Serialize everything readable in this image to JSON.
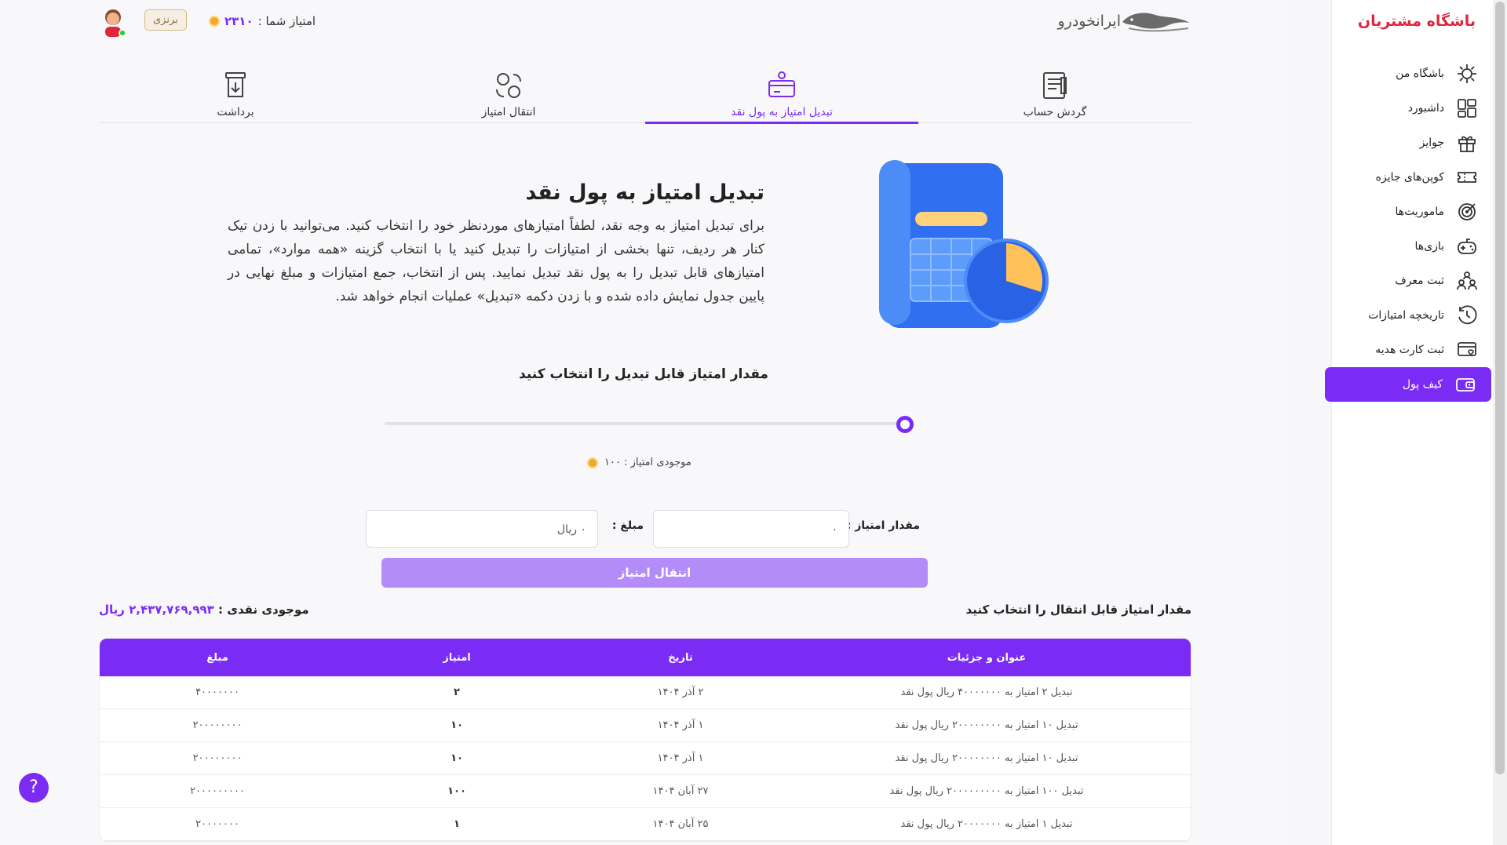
{
  "sidebar": {
    "title": "باشگاه مشتریان",
    "items": [
      {
        "label": "باشگاه من",
        "icon": "club-icon"
      },
      {
        "label": "داشبورد",
        "icon": "dashboard-icon"
      },
      {
        "label": "جوایز",
        "icon": "gift-icon"
      },
      {
        "label": "کوپن‌های جایزه",
        "icon": "ticket-icon"
      },
      {
        "label": "ماموریت‌ها",
        "icon": "target-icon"
      },
      {
        "label": "بازی‌ها",
        "icon": "gamepad-icon"
      },
      {
        "label": "ثبت معرف",
        "icon": "referral-icon"
      },
      {
        "label": "تاریخچه امتیازات",
        "icon": "history-icon"
      },
      {
        "label": "ثبت کارت هدیه",
        "icon": "gift-card-icon"
      },
      {
        "label": "کیف پول",
        "icon": "wallet-icon",
        "active": true
      }
    ]
  },
  "header": {
    "logo_text": "ایرانخودرو",
    "points_label": "امتیاز شما :",
    "points_value": "۲۳۱۰",
    "level_badge": "برنزی"
  },
  "tabs": [
    {
      "label": "گردش حساب",
      "icon": "statement-icon"
    },
    {
      "label": "تبدیل امتیاز به پول نقد",
      "icon": "convert-cash-icon",
      "active": true
    },
    {
      "label": "انتقال امتیاز",
      "icon": "transfer-points-icon"
    },
    {
      "label": "برداشت",
      "icon": "withdraw-icon"
    }
  ],
  "intro": {
    "title": "تبدیل امتیاز به پول نقد",
    "text": "برای تبدیل امتیاز به وجه نقد، لطفاً امتیازهای موردنظر خود را انتخاب کنید. می‌توانید با زدن تیک کنار هر ردیف، تنها بخشی از امتیازات را تبدیل کنید یا با انتخاب گزینه «همه موارد»، تمامی امتیازهای قابل تبدیل را به پول نقد تبدیل نمایید. پس از انتخاب، جمع امتیازات و مبلغ نهایی در پایین جدول نمایش داده شده و با زدن دکمه «تبدیل» عملیات انجام خواهد شد."
  },
  "converter": {
    "title": "مقدار امتیاز قابل تبدیل را انتخاب کنید",
    "slider_fraction": 1.0,
    "balance_text": "موجودی امتیاز : ۱۰۰",
    "points_label": "مقدار امتیاز :",
    "points_value": "۰",
    "amount_label": "مبلغ :",
    "amount_value": "۰ ریال",
    "submit_label": "انتقال امتیاز"
  },
  "summary": {
    "choose_label": "مقدار امتیاز قابل انتقال را انتخاب کنید",
    "cash_label": "موجودی نقدی :",
    "cash_value": "۲,۴۳۷,۷۶۹,۹۹۳ ریال"
  },
  "table": {
    "headers": [
      "عنوان و جزئیات",
      "تاریخ",
      "امتیاز",
      "مبلغ"
    ],
    "rows": [
      [
        "تبدیل ۲ امتیاز به ۴۰۰۰۰۰۰۰ ریال پول نقد",
        "۲ آذر ۱۴۰۴",
        "۲",
        "۴۰۰۰۰۰۰۰"
      ],
      [
        "تبدیل ۱۰ امتیاز به ۲۰۰۰۰۰۰۰۰ ریال پول نقد",
        "۱ آذر ۱۴۰۴",
        "۱۰",
        "۲۰۰۰۰۰۰۰۰"
      ],
      [
        "تبدیل ۱۰ امتیاز به ۲۰۰۰۰۰۰۰۰ ریال پول نقد",
        "۱ آذر ۱۴۰۴",
        "۱۰",
        "۲۰۰۰۰۰۰۰۰"
      ],
      [
        "تبدیل ۱۰۰ امتیاز به ۲۰۰۰۰۰۰۰۰۰ ریال پول نقد",
        "۲۷ آبان ۱۴۰۴",
        "۱۰۰",
        "۲۰۰۰۰۰۰۰۰۰"
      ],
      [
        "تبدیل ۱ امتیاز به ۲۰۰۰۰۰۰۰ ریال پول نقد",
        "۲۵ آبان ۱۴۰۴",
        "۱",
        "۲۰۰۰۰۰۰۰"
      ]
    ]
  },
  "help_label": "?",
  "colors": {
    "accent": "#7a2cf5",
    "brand_red": "#e0263e",
    "button_disabled": "#b48cf8"
  }
}
